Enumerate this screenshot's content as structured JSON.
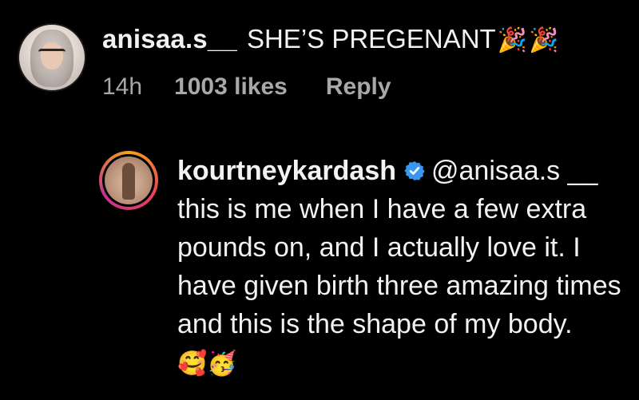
{
  "comment": {
    "username": "anisaa.s__",
    "text": "SHE’S PREGENANT",
    "emojis": [
      "🎉",
      "🎉"
    ],
    "time": "14h",
    "likes": "1003 likes",
    "reply_label": "Reply"
  },
  "reply": {
    "username": "kourtneykardash",
    "verified": true,
    "mention": "@anisaa.s",
    "line_continuation": "__ this is me when I have a few extra pounds on, and I actually love it.  I have given birth three amazing times and this is the shape of my body.",
    "emojis": [
      "🥰",
      "🥳"
    ]
  },
  "colors": {
    "background": "#000000",
    "text": "#f2f2f2",
    "meta": "#a8a8a8",
    "verified_blue": "#3897f0"
  },
  "icons": [
    "verified-badge-icon",
    "party-popper-emoji",
    "smiling-face-with-hearts-emoji",
    "partying-face-emoji"
  ]
}
